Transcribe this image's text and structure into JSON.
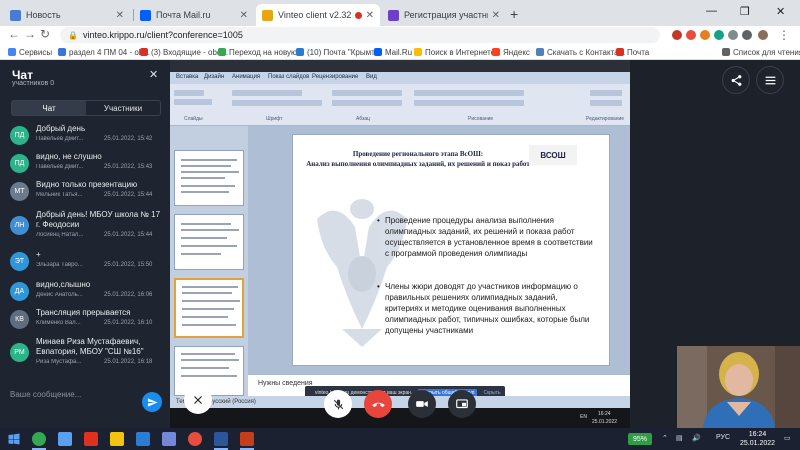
{
  "browser": {
    "tabs": [
      {
        "label": "Новость",
        "favicon_color": "#4a7bd0"
      },
      {
        "label": "Почта Mail.ru",
        "favicon_color": "#005ff9"
      },
      {
        "label": "Vinteo client v2.32.0",
        "favicon_color": "#e8a614"
      },
      {
        "label": "Регистрация участников Устан",
        "favicon_color": "#6d3fc8"
      }
    ],
    "url": "vinteo.krippo.ru/client?conference=1005",
    "bookmarks": [
      {
        "label": "Сервисы",
        "color": "#4285f4"
      },
      {
        "label": "раздел 4 ПМ 04 - ob...",
        "color": "#3a76d6"
      },
      {
        "label": "(3) Входящие - obd...",
        "color": "#d93025"
      },
      {
        "label": "Переход на новую...",
        "color": "#34a853"
      },
      {
        "label": "(10) Почта \"Крымт...",
        "color": "#2a7bd4"
      },
      {
        "label": "Mail.Ru",
        "color": "#005ff9"
      },
      {
        "label": "Поиск в Интернете",
        "color": "#fbbc05"
      },
      {
        "label": "Яндекс",
        "color": "#fc3f1d"
      },
      {
        "label": "Скачать с Контакта...",
        "color": "#5181b8"
      },
      {
        "label": "Почта",
        "color": "#d93025"
      },
      {
        "label": "Список для чтения",
        "color": "#5f6368"
      }
    ]
  },
  "chat": {
    "title": "Чат",
    "subtitle": "участников 0",
    "tab_chat": "Чат",
    "tab_participants": "Участники",
    "input_placeholder": "Ваше сообщение...",
    "messages": [
      {
        "initials": "ПД",
        "color": "#2bb48a",
        "text": "Добрый день",
        "sender": "Павельев Дмит...",
        "time": "25.01.2022, 15:42"
      },
      {
        "initials": "ПД",
        "color": "#2bb48a",
        "text": "видно, не слушно",
        "sender": "Павельев Дмит...",
        "time": "25.01.2022, 15:43"
      },
      {
        "initials": "МТ",
        "color": "#6b7a8c",
        "text": "Видно только презентацию",
        "sender": "Мельник Татья...",
        "time": "25.01.2022, 15:44"
      },
      {
        "initials": "ЛН",
        "color": "#3f8fd2",
        "text": "Добрый день! МБОУ школа № 17",
        "text2": "г. Феодосии",
        "sender": "Лосиенц Натал...",
        "time": "25.01.2022, 15:44"
      },
      {
        "initials": "ЭТ",
        "color": "#2f97d9",
        "text": "+",
        "sender": "Эльзара Тавро...",
        "time": "25.01.2022, 15:50"
      },
      {
        "initials": "ДА",
        "color": "#2f97d9",
        "text": "видно,слышно",
        "sender": "Денис Анатоль...",
        "time": "25.01.2022, 16:06"
      },
      {
        "initials": "КВ",
        "color": "#5f6d7e",
        "text": "Трансляция прерывается",
        "sender": "Клименко Вал...",
        "time": "25.01.2022, 16:10"
      },
      {
        "initials": "РМ",
        "color": "#2bb48a",
        "text": "Минаев Риза Мустафаевич,",
        "text2": "Евпатория, МБОУ \"СШ №16\"",
        "sender": "Риза Мустафа...",
        "time": "25.01.2022, 16:18"
      }
    ]
  },
  "presentation": {
    "ribbon_tabs": [
      "Вставка",
      "Дизайн",
      "Анимация",
      "Показ слайдов",
      "Рецензирование",
      "Вид"
    ],
    "ribbon_groups": [
      "Слайды",
      "Шрифт",
      "Абзац",
      "Рисование",
      "Редактирование"
    ],
    "slide_title": "Проведение регионального этапа ВсОШ:",
    "slide_subtitle": "Анализ выполнения олимпиадных заданий, их решений и показ работ",
    "logo_text": "ВСОШ",
    "bullet1": "Проведение процедуры анализа выполнения олимпиадных заданий, их решений и показа работ осуществляется в установленное время в соответствии с программой проведения олимпиады",
    "bullet2": "Члены жюри доводят до участников информацию о правильных решениях олимпиадных заданий, критериях и методике оценивания выполненных олимпиадных работ, типичных ошибках, которые были допущены участниками",
    "notes": "Нужны сведения",
    "status": "Тема Office   русский (Россия)",
    "share_notice": "vinteo.krippo.ru демонстрирует ваш экран.",
    "share_btn": "Закрыть общий доступ",
    "share_hide": "Скрыть",
    "guest_clock": "16:24",
    "guest_date": "25.01.2022",
    "guest_lang": "EN"
  },
  "taskbar": {
    "battery": "95%",
    "lang": "РУС",
    "time": "16:24",
    "date": "25.01.2022"
  }
}
